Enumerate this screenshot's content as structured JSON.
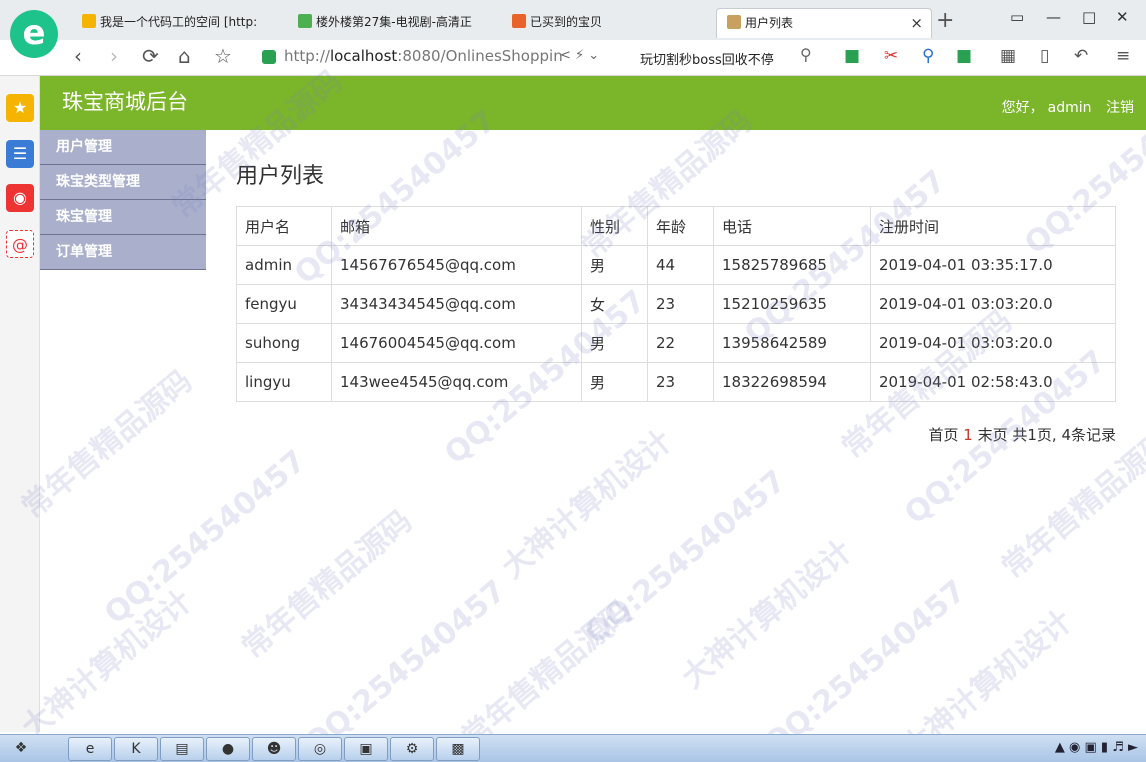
{
  "browser": {
    "tabs": [
      {
        "label": "我是一个代码工的空间 [http:",
        "icon_color": "#f5b400"
      },
      {
        "label": "楼外楼第27集-电视剧-高清正",
        "icon_color": "#4caf50"
      },
      {
        "label": "已买到的宝贝",
        "icon_color": "#e8622a"
      },
      {
        "label": "用户列表",
        "icon_color": "#c8a060"
      }
    ],
    "url_prefix": "http://",
    "url_host": "localhost",
    "url_rest": ":8080/OnlinesShoppin",
    "search_text": "玩切割秒boss回收不停",
    "new_tab": "+",
    "close_glyph": "×"
  },
  "app": {
    "title": "珠宝商城后台",
    "greeting": "您好，",
    "username": "admin",
    "logout": "注销",
    "header_color": "#7ab52a"
  },
  "menu": [
    {
      "label": "用户管理"
    },
    {
      "label": "珠宝类型管理"
    },
    {
      "label": "珠宝管理"
    },
    {
      "label": "订单管理"
    }
  ],
  "main": {
    "page_title": "用户列表",
    "columns": [
      "用户名",
      "邮箱",
      "性别",
      "年龄",
      "电话",
      "注册时间"
    ],
    "rows": [
      [
        "admin",
        "14567676545@qq.com",
        "男",
        "44",
        "15825789685",
        "2019-04-01 03:35:17.0"
      ],
      [
        "fengyu",
        "34343434545@qq.com",
        "女",
        "23",
        "15210259635",
        "2019-04-01 03:03:20.0"
      ],
      [
        "suhong",
        "14676004545@qq.com",
        "男",
        "22",
        "13958642589",
        "2019-04-01 03:03:20.0"
      ],
      [
        "lingyu",
        "143wee4545@qq.com",
        "男",
        "23",
        "18322698594",
        "2019-04-01 02:58:43.0"
      ]
    ],
    "pager": {
      "first": "首页",
      "current": "1",
      "last": "末页",
      "summary": "共1页, 4条记录"
    }
  },
  "watermarks": [
    "QQ:254540457",
    "常年售精品源码",
    "大神计算机设计"
  ]
}
